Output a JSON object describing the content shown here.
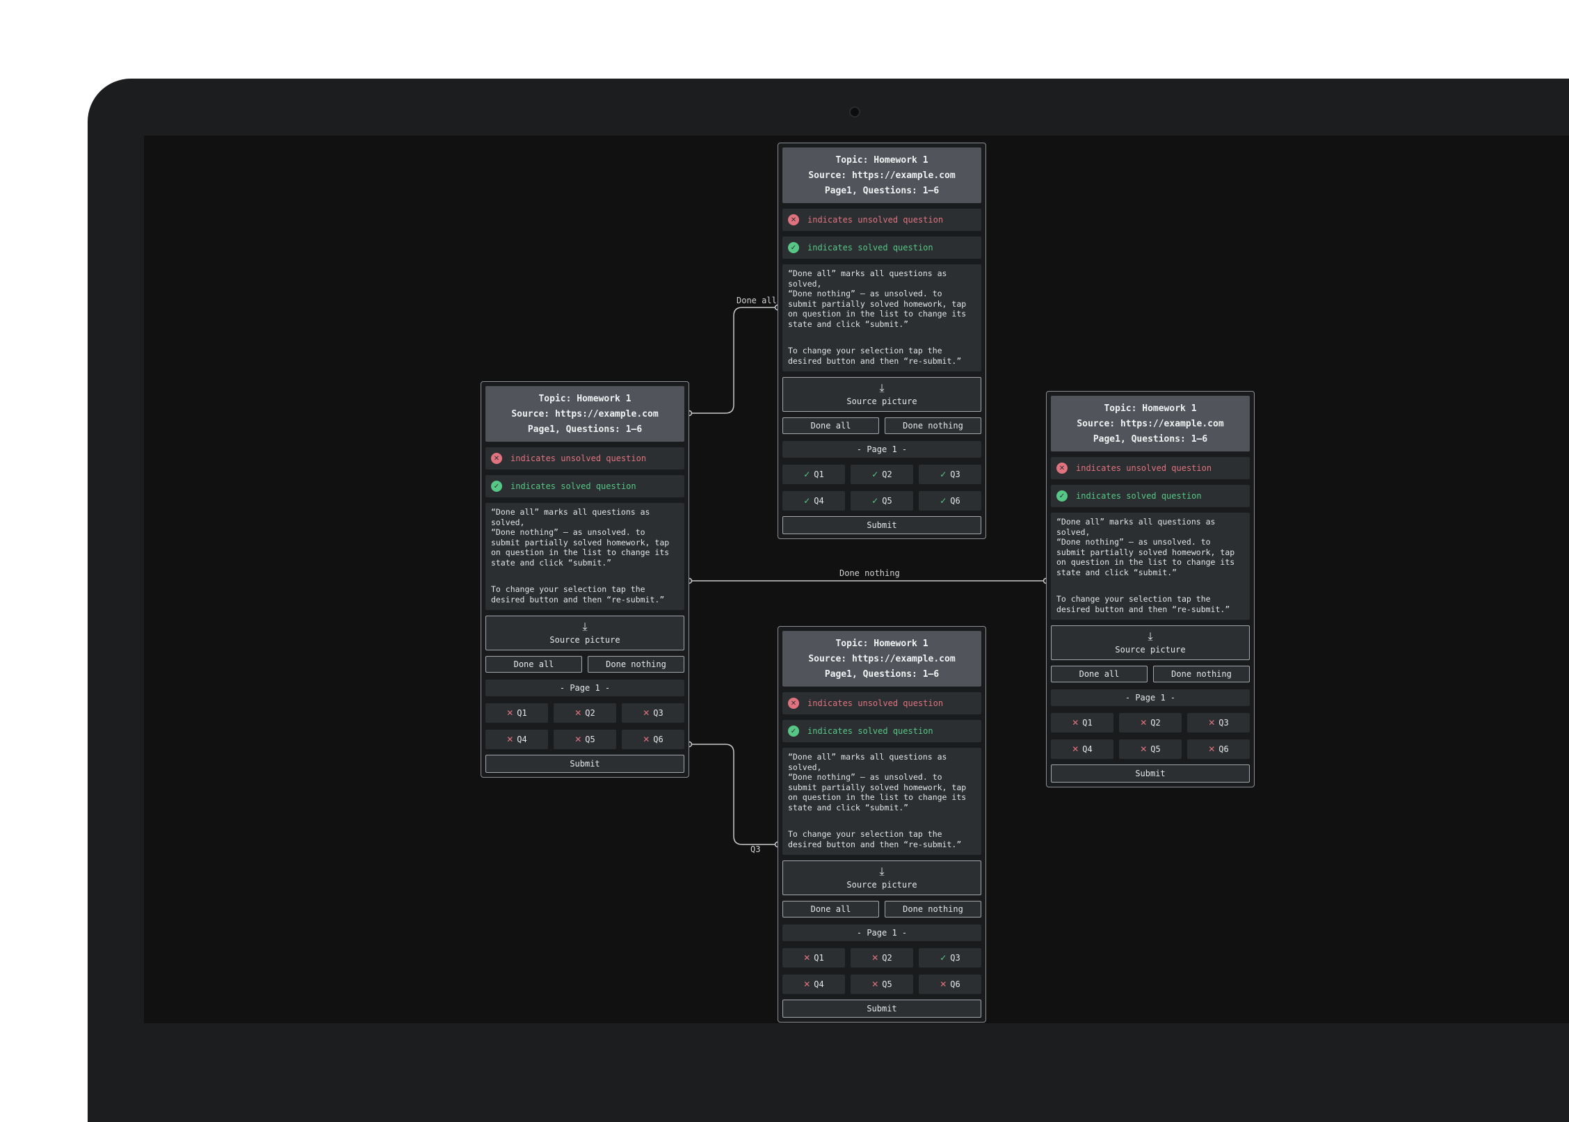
{
  "card_template": {
    "topic": "Topic: Homework 1",
    "source": "Source: https://example.com",
    "page_info": "Page1, Questions: 1–6",
    "unsolved_legend": "indicates unsolved question",
    "solved_legend": "indicates solved question",
    "help_text_1": "“Done all” marks all questions as solved,\n“Done nothing” – as unsolved. to submit partially solved homework, tap on question in the list to change its state and click “submit.”",
    "help_text_2": "To change your selection tap the desired button and then “re-submit.”",
    "source_picture_label": "Source picture",
    "done_all_label": "Done all",
    "done_nothing_label": "Done nothing",
    "page_label": "- Page 1 -",
    "submit_label": "Submit"
  },
  "nodes": [
    {
      "id": "initial",
      "questions": [
        {
          "label": "Q1",
          "solved": false
        },
        {
          "label": "Q2",
          "solved": false
        },
        {
          "label": "Q3",
          "solved": false
        },
        {
          "label": "Q4",
          "solved": false
        },
        {
          "label": "Q5",
          "solved": false
        },
        {
          "label": "Q6",
          "solved": false
        }
      ]
    },
    {
      "id": "after-done-all",
      "questions": [
        {
          "label": "Q1",
          "solved": true
        },
        {
          "label": "Q2",
          "solved": true
        },
        {
          "label": "Q3",
          "solved": true
        },
        {
          "label": "Q4",
          "solved": true
        },
        {
          "label": "Q5",
          "solved": true
        },
        {
          "label": "Q6",
          "solved": true
        }
      ]
    },
    {
      "id": "after-done-nothing",
      "questions": [
        {
          "label": "Q1",
          "solved": false
        },
        {
          "label": "Q2",
          "solved": false
        },
        {
          "label": "Q3",
          "solved": false
        },
        {
          "label": "Q4",
          "solved": false
        },
        {
          "label": "Q5",
          "solved": false
        },
        {
          "label": "Q6",
          "solved": false
        }
      ]
    },
    {
      "id": "after-q3",
      "questions": [
        {
          "label": "Q1",
          "solved": false
        },
        {
          "label": "Q2",
          "solved": false
        },
        {
          "label": "Q3",
          "solved": true
        },
        {
          "label": "Q4",
          "solved": false
        },
        {
          "label": "Q5",
          "solved": false
        },
        {
          "label": "Q6",
          "solved": false
        }
      ]
    }
  ],
  "transitions": {
    "done_all": "Done all",
    "done_nothing": "Done nothing",
    "q3": "Q3"
  },
  "icons": {
    "unsolved": "x-circle-icon",
    "solved": "check-circle-icon",
    "download": "download-icon"
  },
  "colors": {
    "unsolved": "#e0737e",
    "solved": "#56c785",
    "header": "#51555b",
    "panel": "#2c2f32"
  }
}
